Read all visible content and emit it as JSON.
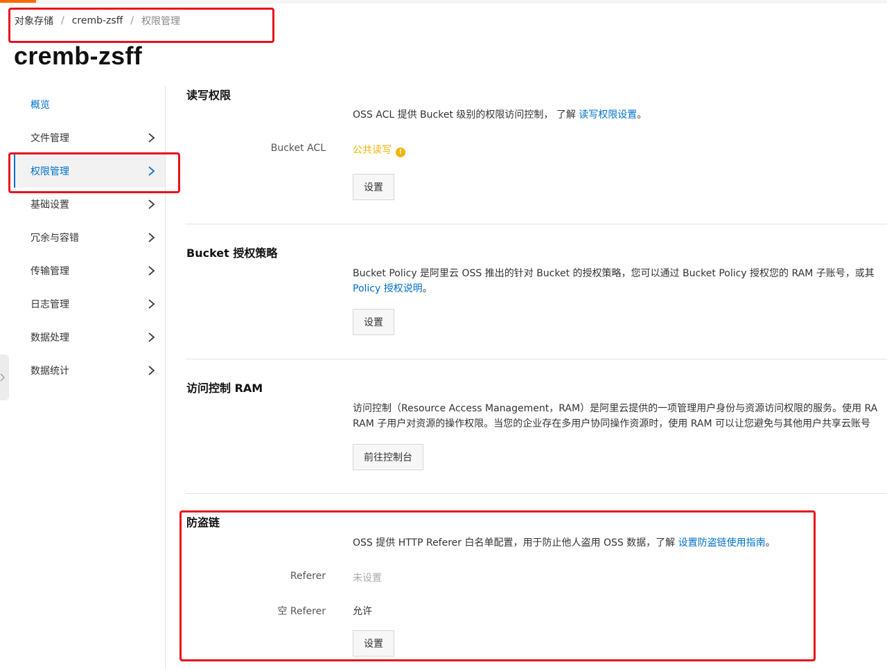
{
  "colors": {
    "brand": "#ff6a00",
    "link": "#0070cc",
    "warning": "#f0b400",
    "highlight_box": "#e8101c"
  },
  "breadcrumb": {
    "items": [
      "对象存储",
      "cremb-zsff",
      "权限管理"
    ],
    "separator": "/"
  },
  "page_title": "cremb-zsff",
  "sidebar": {
    "items": [
      {
        "label": "概览",
        "icon": null
      },
      {
        "label": "文件管理",
        "icon": "chevron-right-icon"
      },
      {
        "label": "权限管理",
        "icon": "chevron-right-icon",
        "selected": true
      },
      {
        "label": "基础设置",
        "icon": "chevron-right-icon"
      },
      {
        "label": "冗余与容错",
        "icon": "chevron-right-icon"
      },
      {
        "label": "传输管理",
        "icon": "chevron-right-icon"
      },
      {
        "label": "日志管理",
        "icon": "chevron-right-icon"
      },
      {
        "label": "数据处理",
        "icon": "chevron-right-icon"
      },
      {
        "label": "数据统计",
        "icon": "chevron-right-icon"
      }
    ]
  },
  "sections": {
    "acl": {
      "title": "读写权限",
      "desc": "OSS ACL 提供 Bucket 级别的权限访问控制， 了解 ",
      "link": "读写权限设置",
      "desc_end": "。",
      "field_label": "Bucket ACL",
      "field_value": "公共读写",
      "warning_icon": "!",
      "button": "设置"
    },
    "policy": {
      "title": "Bucket 授权策略",
      "desc_line1": "Bucket Policy 是阿里云 OSS 推出的针对 Bucket 的授权策略，您可以通过 Bucket Policy 授权您的 RAM 子账号，或其",
      "link": "Policy 授权说明",
      "desc_end": "。",
      "button": "设置"
    },
    "ram": {
      "title": "访问控制 RAM",
      "desc_line1": "访问控制（Resource Access Management，RAM）是阿里云提供的一项管理用户身份与资源访问权限的服务。使用 RA",
      "desc_line2": "RAM 子用户对资源的操作权限。当您的企业存在多用户协同操作资源时，使用 RAM 可以让您避免与其他用户共享云账号",
      "button": "前往控制台"
    },
    "hotlink": {
      "title": "防盗链",
      "desc": "OSS 提供 HTTP Referer 白名单配置，用于防止他人盗用 OSS 数据，了解 ",
      "link": "设置防盗链使用指南",
      "desc_end": "。",
      "referer_label": "Referer",
      "referer_value": "未设置",
      "empty_referer_label": "空 Referer",
      "empty_referer_value": "允许",
      "button": "设置"
    }
  }
}
